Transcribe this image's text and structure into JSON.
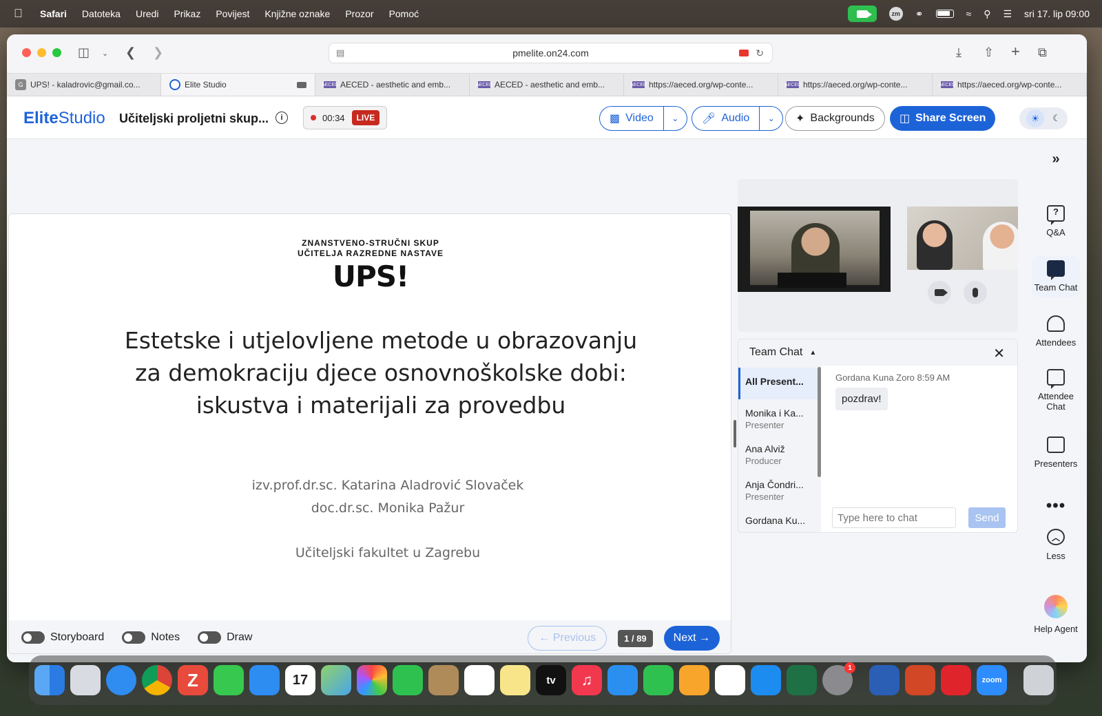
{
  "menubar": {
    "app": "Safari",
    "items": [
      "Datoteka",
      "Uredi",
      "Prikaz",
      "Povijest",
      "Knjižne oznake",
      "Prozor",
      "Pomoć"
    ],
    "zoom_badge": "zm",
    "datetime": "sri 17. lip 09:00"
  },
  "browser": {
    "url": "pmelite.on24.com",
    "tabs": [
      {
        "label": "UPS! - kaladrovic@gmail.co...",
        "favicon": "G"
      },
      {
        "label": "Elite Studio"
      },
      {
        "label": "AECED - aesthetic and emb...",
        "favicon": "AECED"
      },
      {
        "label": "AECED - aesthetic and emb...",
        "favicon": "AECED"
      },
      {
        "label": "https://aeced.org/wp-conte...",
        "favicon": "AECED"
      },
      {
        "label": "https://aeced.org/wp-conte...",
        "favicon": "AECED"
      },
      {
        "label": "https://aeced.org/wp-conte...",
        "favicon": "AECED"
      }
    ]
  },
  "header": {
    "logo_bold": "Elite",
    "logo_light": "Studio",
    "event_title": "Učiteljski proljetni skup...",
    "info": "i",
    "timer": "00:34",
    "live": "LIVE",
    "video": "Video",
    "audio": "Audio",
    "backgrounds": "Backgrounds",
    "share_screen": "Share Screen"
  },
  "slide": {
    "kicker_line1": "ZNANSTVENO-STRUČNI SKUP",
    "kicker_line2": "UČITELJA RAZREDNE NASTAVE",
    "big_title": "UPS!",
    "headline": "Estetske i utjelovljene metode u obrazovanju za demokraciju djece osnovnoškolske dobi: iskustva i materijali za provedbu",
    "author1": "izv.prof.dr.sc. Katarina Aladrović Slovaček",
    "author2": "doc.dr.sc. Monika Pažur",
    "faculty": "Učiteljski fakultet u Zagrebu"
  },
  "slide_footer": {
    "storyboard": "Storyboard",
    "notes": "Notes",
    "draw": "Draw",
    "previous": "← Previous",
    "page": "1 / 89",
    "next": "Next →"
  },
  "chat": {
    "title": "Team Chat",
    "close": "✕",
    "recipients": [
      {
        "name": "All Present..."
      },
      {
        "name": "Monika i Ka...",
        "role": "Presenter"
      },
      {
        "name": "Ana Alviž",
        "role": "Producer"
      },
      {
        "name": "Anja Čondri...",
        "role": "Presenter"
      },
      {
        "name": "Gordana Ku..."
      }
    ],
    "message_author": "Gordana Kuna Zoro",
    "message_time": "8:59 AM",
    "message_text": "pozdrav!",
    "input_placeholder": "Type here to chat",
    "send": "Send"
  },
  "rail": {
    "expand": "»",
    "qa": "Q&A",
    "qa_glyph": "?",
    "team_chat": "Team Chat",
    "attendees": "Attendees",
    "attendee_chat_line1": "Attendee",
    "attendee_chat_line2": "Chat",
    "presenters": "Presenters",
    "more": "•••",
    "less": "Less",
    "less_glyph": "︿",
    "help_agent": "Help Agent"
  },
  "dock": {
    "calendar_day": "17",
    "appletv": "tv",
    "settings_badge": "1",
    "zoom": "zoom"
  },
  "colors": {
    "brand": "#1d63d8",
    "live": "#c7291f",
    "send_disabled": "#a9c4f0"
  }
}
